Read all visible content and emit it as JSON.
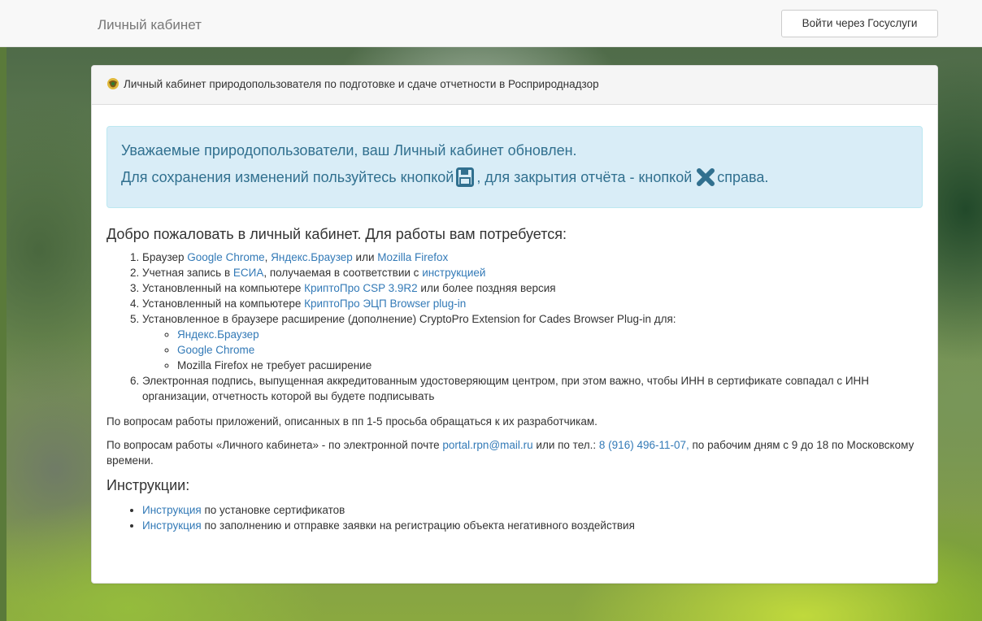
{
  "navbar": {
    "brand": "Личный кабинет",
    "login_button": "Войти через Госуслуги"
  },
  "panel": {
    "heading": "Личный кабинет природопользователя по подготовке и сдаче отчетности в Росприроднадзор"
  },
  "alert": {
    "line1": "Уважаемые природопользователи, ваш Личный кабинет обновлен.",
    "line2_a": "Для сохранения изменений пользуйтесь кнопкой",
    "line2_b": ", для закрытия отчёта - кнопкой",
    "line2_c": "справа."
  },
  "welcome": "Добро пожаловать в личный кабинет. Для работы вам потребуется:",
  "requirements": {
    "r1": {
      "pre": "Браузер ",
      "link1": "Google Chrome",
      "sep1": ", ",
      "link2": "Яндекс.Браузер",
      "sep2": " или ",
      "link3": "Mozilla Firefox"
    },
    "r2": {
      "pre": "Учетная запись в ",
      "link1": "ЕСИА",
      "mid": ", получаемая в соответствии с ",
      "link2": "инструкцией"
    },
    "r3": {
      "pre": "Установленный на компьютере ",
      "link": "КриптоПро CSP 3.9R2",
      "post": " или более поздняя версия"
    },
    "r4": {
      "pre": "Установленный на компьютере ",
      "link": "КриптоПро ЭЦП Browser plug-in"
    },
    "r5": {
      "text": "Установленное в браузере расширение (дополнение) CryptoPro Extension for Cades Browser Plug-in для:",
      "sub1": "Яндекс.Браузер",
      "sub2": "Google Chrome",
      "sub3": "Mozilla Firefox не требует расширение"
    },
    "r6": "Электронная подпись, выпущенная аккредитованным удостоверяющим центром, при этом важно, чтобы ИНН в сертификате совпадал с ИНН организации, отчетность которой вы будете подписывать"
  },
  "support_apps": "По вопросам работы приложений, описанных в пп 1-5 просьба обращаться к их разработчикам.",
  "support_cabinet": {
    "pre": "По вопросам работы «Личного кабинета» - по электронной почте ",
    "email": "portal.rpn@mail.ru",
    "mid": " или по тел.: ",
    "phone": "8 (916) 496-11-07,",
    "post": " по рабочим дням с 9 до 18 по Московскому времени."
  },
  "instructions": {
    "title": "Инструкции:",
    "i1_link": "Инструкция",
    "i1_text": " по установке сертификатов",
    "i2_link": "Инструкция",
    "i2_text": " по заполнению и отправке заявки на регистрацию объекта негативного воздействия"
  },
  "icons": {
    "save": "floppy-disk-icon",
    "close": "close-x-icon",
    "emblem": "rpn-emblem-icon"
  },
  "colors": {
    "link": "#337ab7",
    "alert_bg": "#d9edf7",
    "alert_text": "#31708f"
  }
}
